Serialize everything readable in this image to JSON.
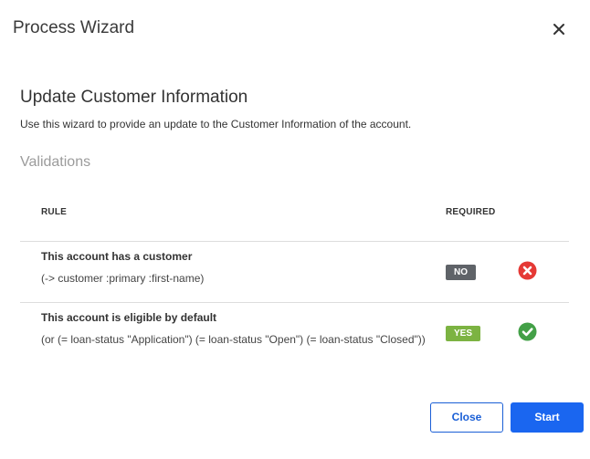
{
  "dialog": {
    "title": "Process Wizard",
    "close_icon": "close-icon"
  },
  "section": {
    "title": "Update Customer Information",
    "description": "Use this wizard to provide an update to the Customer Information of the account.",
    "subheading": "Validations"
  },
  "table": {
    "headers": {
      "rule": "RULE",
      "required": "REQUIRED"
    },
    "rows": [
      {
        "title": "This account has a customer",
        "expression": "(-> customer :primary :first-name)",
        "required": "NO",
        "status_icon": "error-circle-icon",
        "status_color": "#e53935"
      },
      {
        "title": "This account is eligible by default",
        "expression": "(or (= loan-status \"Application\") (= loan-status \"Open\") (= loan-status \"Closed\"))",
        "required": "YES",
        "status_icon": "check-circle-icon",
        "status_color": "#43a047"
      }
    ]
  },
  "footer": {
    "close_label": "Close",
    "start_label": "Start"
  },
  "colors": {
    "primary": "#1a66f0",
    "badge_no": "#5f6368",
    "badge_yes": "#7cb342"
  }
}
